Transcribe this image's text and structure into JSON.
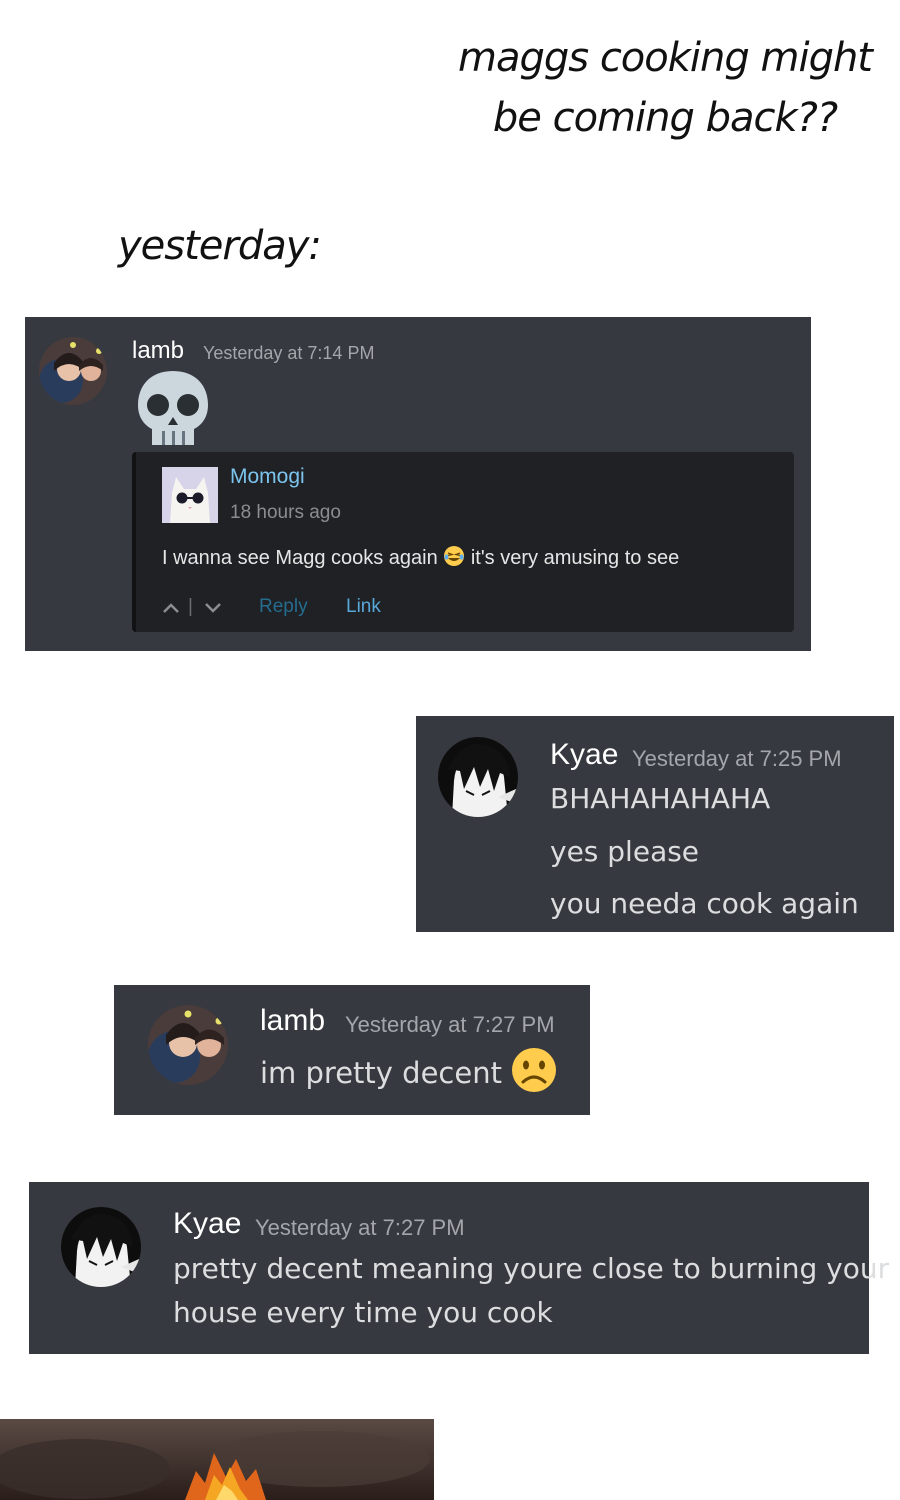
{
  "caption": {
    "headline_lines": [
      "maggs cooking might",
      "be coming back??"
    ],
    "subhead": "yesterday:"
  },
  "messages": [
    {
      "username": "lamb",
      "timestamp": "Yesterday at 7:14 PM",
      "avatar": "photo-avatar",
      "content_emoji": "skull",
      "embed": {
        "author": "Momogi",
        "time": "18 hours ago",
        "avatar": "white-cat-with-sunglasses",
        "comment_before_emoji": "I wanna see Magg cooks again",
        "comment_emoji": "face-with-tears-of-joy",
        "comment_after_emoji": "it's very amusing to see",
        "actions": {
          "upvote_icon": "chevron-up",
          "separator": "|",
          "downvote_icon": "chevron-down",
          "reply": "Reply",
          "link": "Link"
        }
      }
    },
    {
      "username": "Kyae",
      "timestamp": "Yesterday at 7:25 PM",
      "avatar": "anime-avatar",
      "lines": [
        "BHAHAHAHAHA",
        "yes please",
        "you needa cook again"
      ]
    },
    {
      "username": "lamb",
      "timestamp": "Yesterday at 7:27 PM",
      "avatar": "photo-avatar",
      "text": "im pretty decent",
      "emoji": "slightly-frowning-face"
    },
    {
      "username": "Kyae",
      "timestamp": "Yesterday at 7:27 PM",
      "avatar": "anime-avatar",
      "lines": [
        "pretty decent meaning youre close to burning your",
        "house every time you cook"
      ]
    }
  ],
  "colors": {
    "page_bg": "#ffffff",
    "card_bg": "#36393f",
    "embed_bg": "#1f2124",
    "username": "#ffffff",
    "timestamp": "#a3a6aa",
    "message_text": "#dcddde",
    "embed_author": "#7cc4ee",
    "link": "#58a8d8",
    "emoji_yellow": "#ffcc4d"
  },
  "photo": {
    "subject": "fire"
  }
}
